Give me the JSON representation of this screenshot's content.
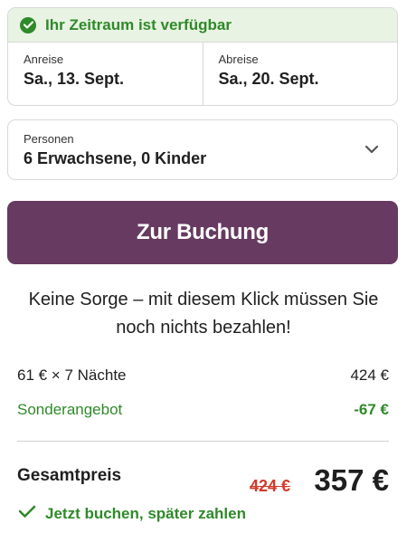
{
  "availability": {
    "message": "Ihr Zeitraum ist verfügbar",
    "icon": "check-circle-icon",
    "color": "#2f8a29"
  },
  "dates": {
    "arrival": {
      "label": "Anreise",
      "value": "Sa., 13. Sept."
    },
    "departure": {
      "label": "Abreise",
      "value": "Sa., 20. Sept."
    }
  },
  "guests": {
    "label": "Personen",
    "value": "6 Erwachsene, 0 Kinder",
    "icon": "chevron-down-icon"
  },
  "booking": {
    "button_label": "Zur Buchung",
    "button_color": "#663a61"
  },
  "note": {
    "line1": "Keine Sorge – mit diesem Klick müssen Sie",
    "line2": "noch nichts bezahlen!"
  },
  "price_breakdown": {
    "nights": {
      "label": "61 € × 7 Nächte",
      "amount": "424 €"
    },
    "special": {
      "label": "Sonderangebot",
      "amount": "-67 €"
    }
  },
  "total": {
    "label": "Gesamtpreis",
    "old_price": "424 €",
    "new_price": "357 €"
  },
  "pay_later": {
    "text": "Jetzt buchen, später zahlen",
    "icon": "check-icon"
  }
}
